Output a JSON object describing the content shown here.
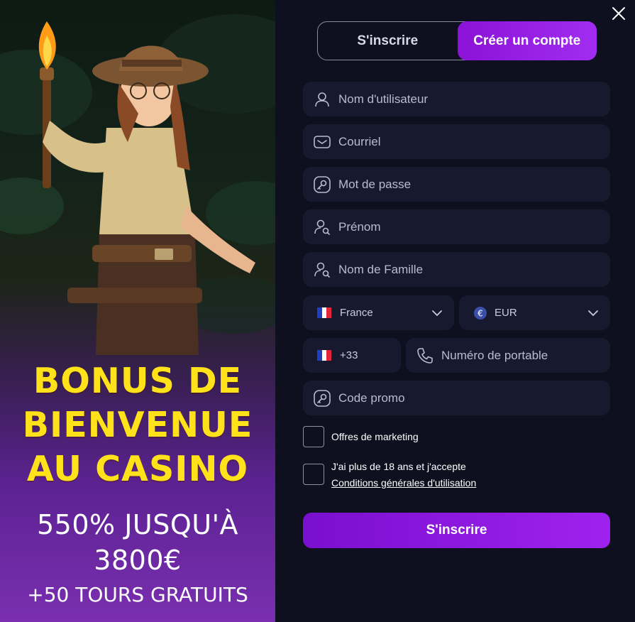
{
  "promo": {
    "headline_lines": [
      "BONUS DE",
      "BIENVENUE",
      "AU CASINO"
    ],
    "amount_lines": [
      "550% JUSQU'À",
      "3800€"
    ],
    "spins": "+50 TOURS GRATUITS"
  },
  "tabs": [
    {
      "label": "S'inscrire",
      "active": false
    },
    {
      "label": "Créer un compte",
      "active": true
    }
  ],
  "form": {
    "username": {
      "placeholder": "Nom d'utilisateur",
      "icon": "user-icon"
    },
    "email": {
      "placeholder": "Courriel",
      "icon": "mail-icon"
    },
    "password": {
      "placeholder": "Mot de passe",
      "icon": "key-icon"
    },
    "first_name": {
      "placeholder": "Prénom",
      "icon": "user-search-icon"
    },
    "last_name": {
      "placeholder": "Nom de Famille",
      "icon": "user-search-icon"
    },
    "country": {
      "value": "France",
      "icon": "france-flag-icon"
    },
    "currency": {
      "value": "EUR",
      "icon": "euro-coin-icon"
    },
    "phone_code": {
      "value": "+33",
      "icon": "france-flag-icon"
    },
    "phone": {
      "placeholder": "Numéro de portable",
      "icon": "phone-icon"
    },
    "promo_code": {
      "placeholder": "Code promo",
      "icon": "key-icon"
    },
    "marketing_label": "Offres de marketing",
    "terms_label": "J'ai plus de 18 ans et j'accepte",
    "terms_link": "Conditions générales d'utilisation",
    "submit_label": "S'inscrire"
  },
  "colors": {
    "accent": "#9f22ee",
    "headline": "#ffe21a",
    "panel_bg": "#0e1020",
    "field_bg": "#171a2e"
  }
}
